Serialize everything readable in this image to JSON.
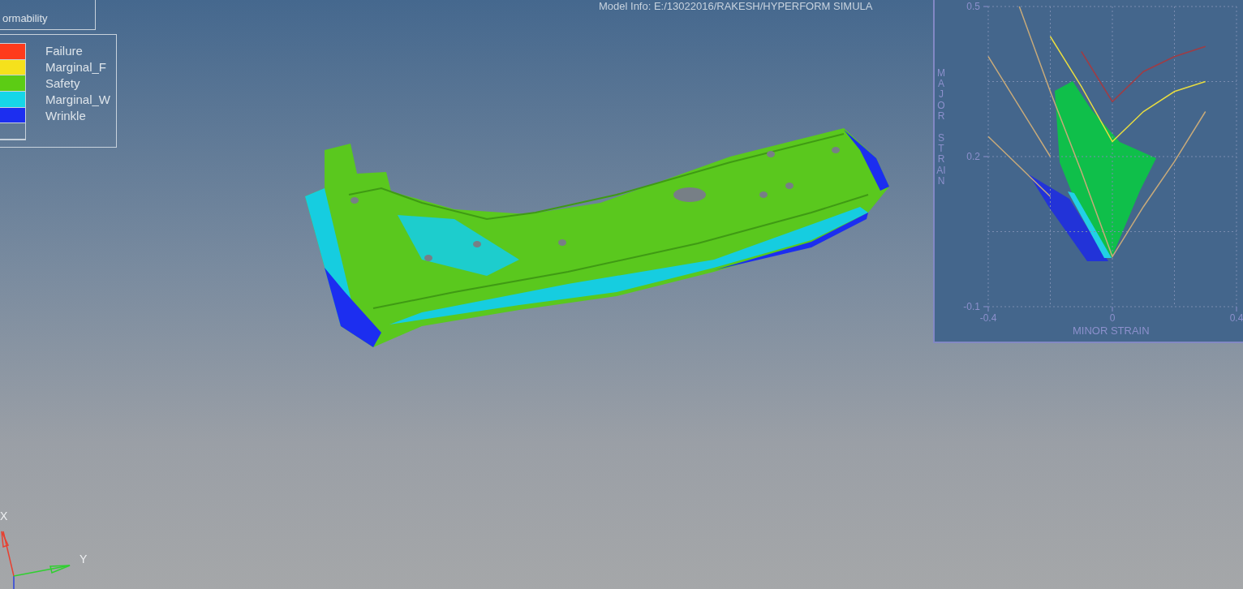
{
  "model_info": "Model Info: E:/13022016/RAKESH/HYPERFORM SIMULA",
  "result_box": {
    "title": "ormability"
  },
  "legend": {
    "items": [
      {
        "label": "Failure",
        "color": "#ff3a1c"
      },
      {
        "label": "Marginal_F",
        "color": "#f5e11c"
      },
      {
        "label": "Safety",
        "color": "#5ccc14"
      },
      {
        "label": "Marginal_W",
        "color": "#16d6e8"
      },
      {
        "label": "Wrinkle",
        "color": "#1c2ef0"
      }
    ]
  },
  "fld_panel": {
    "chart_data": {
      "type": "line",
      "xlabel": "MINOR STRAIN",
      "ylabel": "MAJOR STRAIN",
      "x": [
        -0.4,
        -0.3,
        -0.2,
        -0.1,
        0,
        0.1,
        0.2,
        0.3
      ],
      "series": [
        {
          "color": "#a03c44",
          "values": [
            null,
            null,
            null,
            0.41,
            0.31,
            0.37,
            0.4,
            0.42
          ]
        },
        {
          "color": "#e8dc40",
          "values": [
            null,
            null,
            0.44,
            0.34,
            0.23,
            0.29,
            0.33,
            0.35
          ]
        },
        {
          "color": "#c8aa7a",
          "values": [
            null,
            0.5,
            0.33,
            0.17,
            0.0,
            0.1,
            0.19,
            0.29
          ]
        },
        {
          "color": "#c8aa7a",
          "values": [
            0.4,
            0.3,
            0.2,
            null,
            null,
            null,
            null,
            null
          ]
        },
        {
          "color": "#c8aa7a",
          "values": [
            0.24,
            0.18,
            0.12,
            null,
            null,
            null,
            null,
            null
          ]
        }
      ],
      "xlim": [
        -0.4,
        0.4
      ],
      "ylim": [
        -0.1,
        0.5
      ],
      "xticks": [
        -0.4,
        0,
        0.4
      ],
      "yticks": [
        -0.1,
        0.2,
        0.5
      ]
    }
  },
  "triad": {
    "x_label": "X",
    "y_label": "Y"
  }
}
